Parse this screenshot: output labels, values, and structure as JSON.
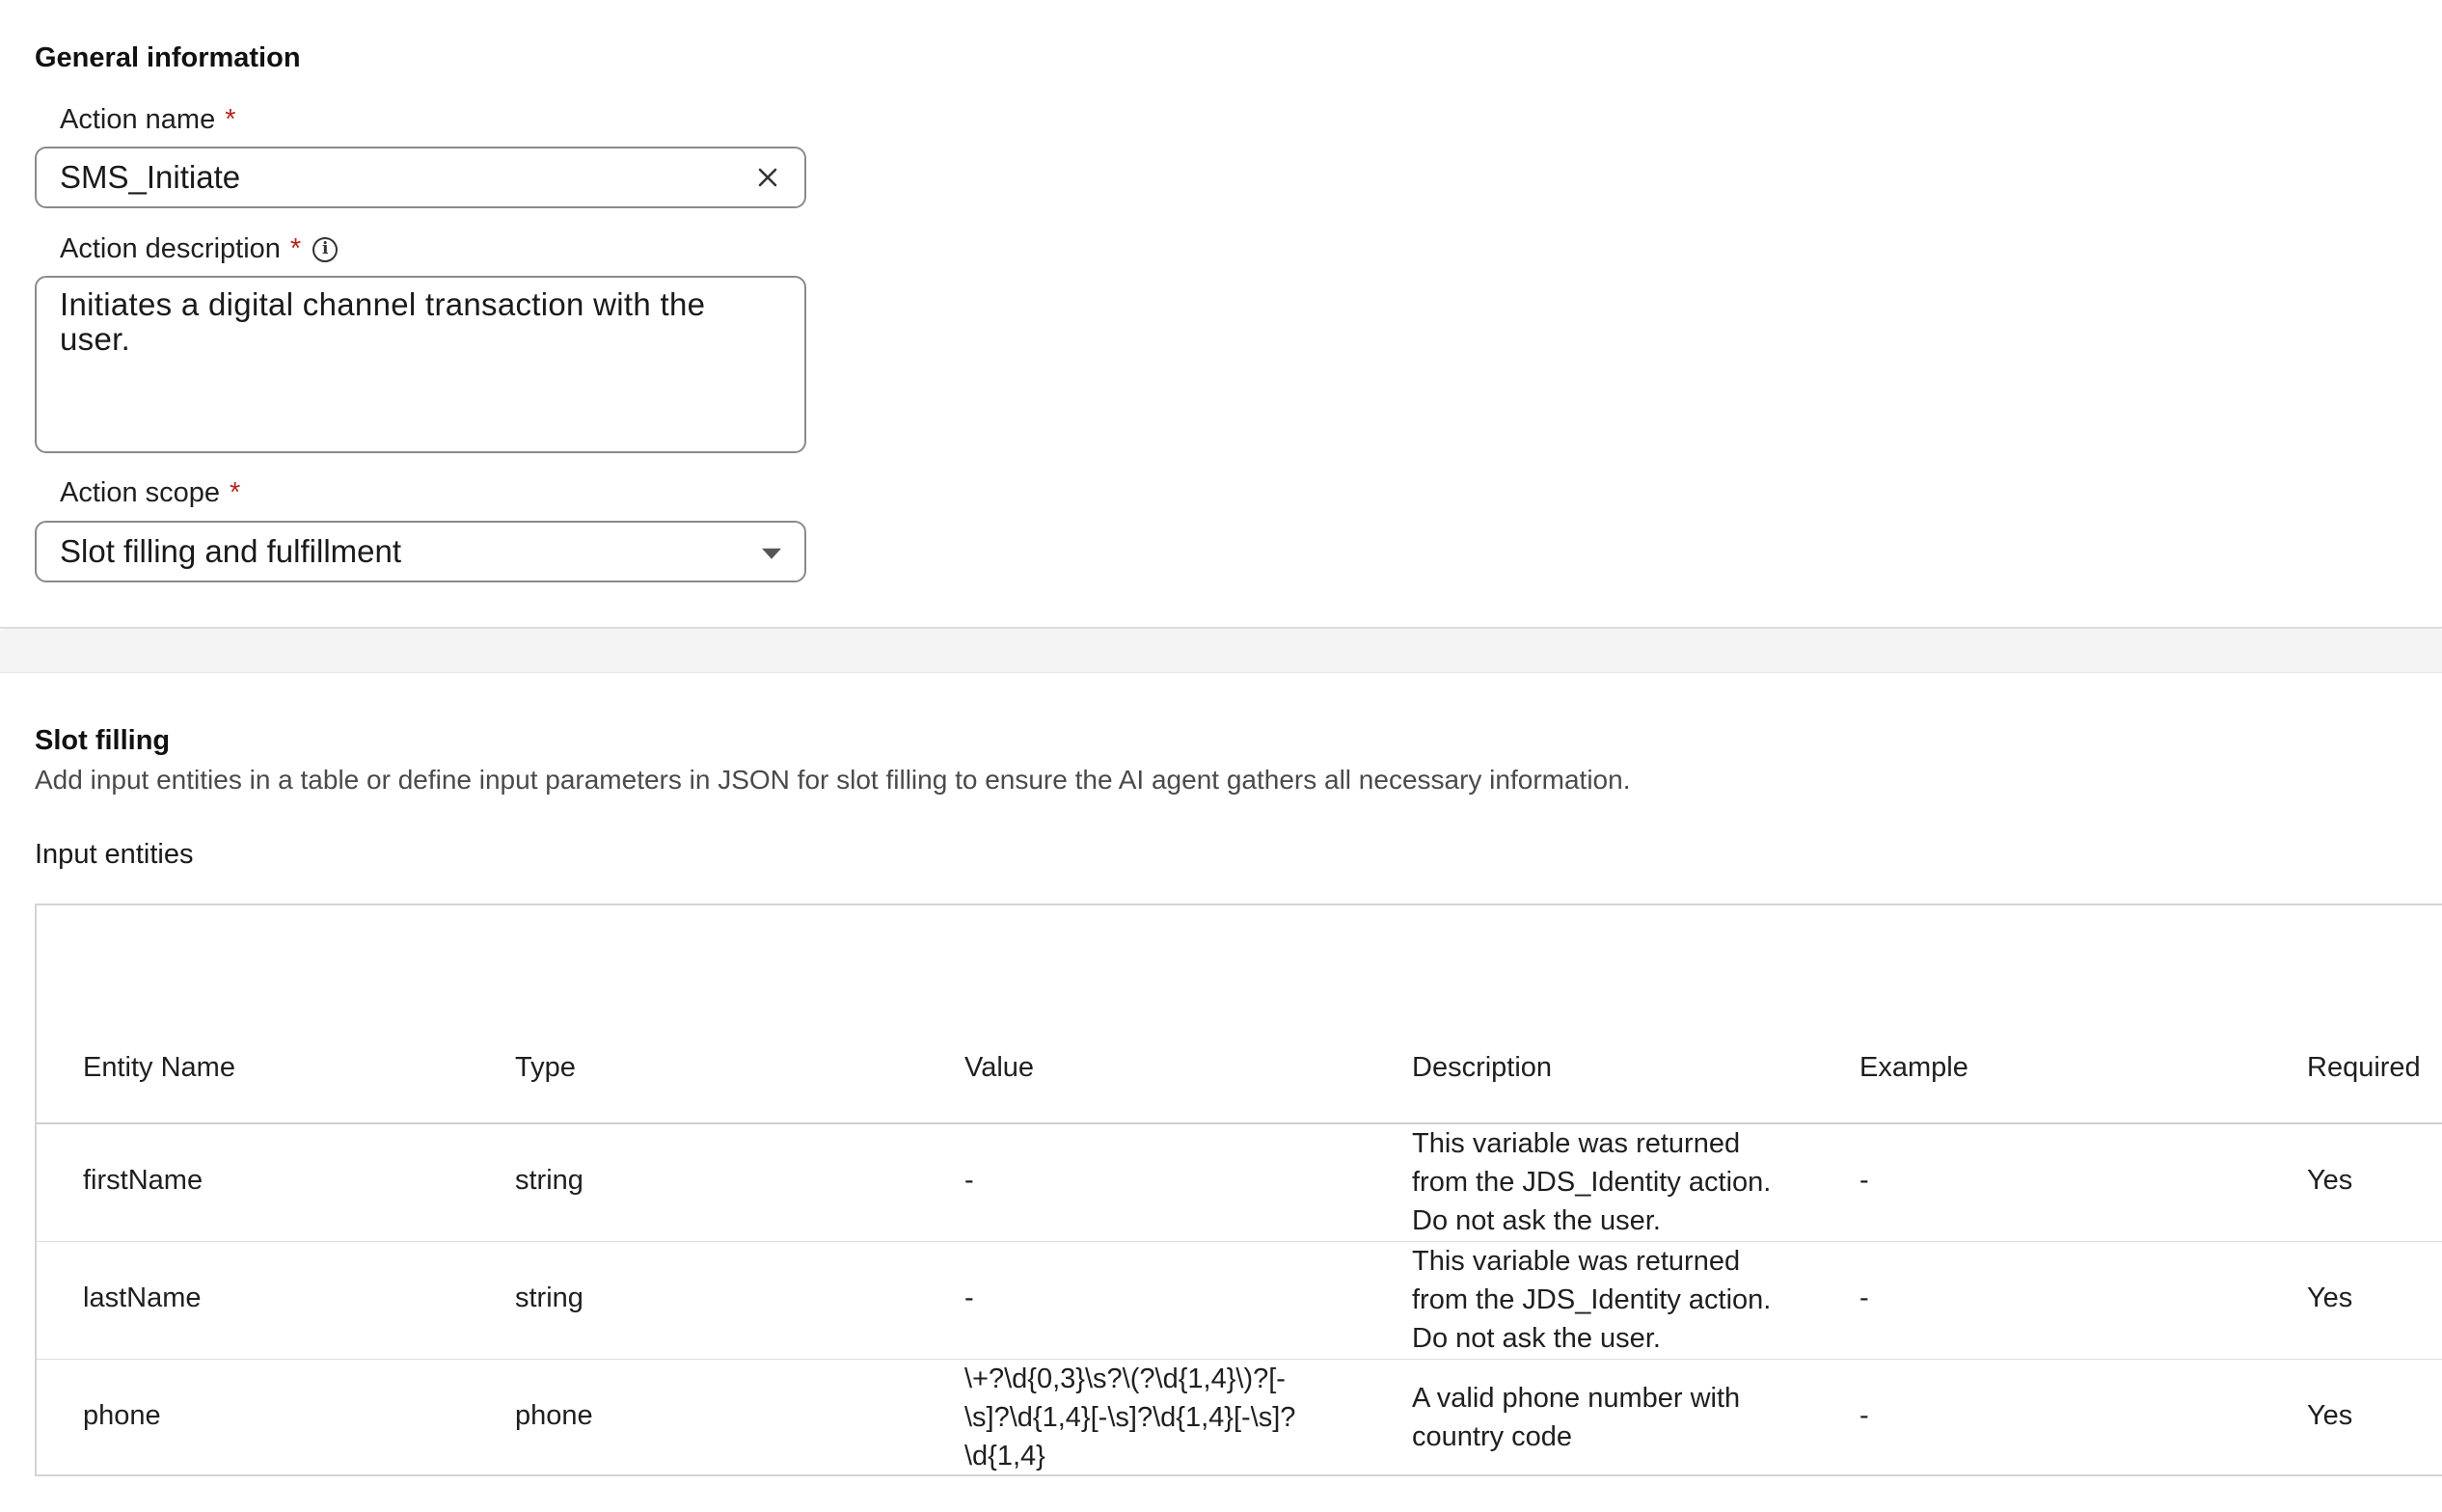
{
  "general": {
    "title": "General information",
    "action_name": {
      "label": "Action name",
      "required_mark": "*",
      "value": "SMS_Initiate"
    },
    "action_description": {
      "label": "Action description",
      "required_mark": "*",
      "info_icon_glyph": "i",
      "value": "Initiates a digital channel transaction with the user."
    },
    "action_scope": {
      "label": "Action scope",
      "required_mark": "*",
      "value": "Slot filling and fulfillment"
    }
  },
  "slot_filling": {
    "title": "Slot filling",
    "description": "Add input entities in a table or define input parameters in JSON for slot filling to ensure the AI agent gathers all necessary information.",
    "input_entities_label": "Input entities",
    "table": {
      "columns": [
        "Entity Name",
        "Type",
        "Value",
        "Description",
        "Example",
        "Required"
      ],
      "rows": [
        {
          "entity": "firstName",
          "type": "string",
          "value": [
            "-"
          ],
          "description": [
            "This variable was returned",
            "from the JDS_Identity action.",
            "Do not ask the user."
          ],
          "example": "-",
          "required": "Yes"
        },
        {
          "entity": "lastName",
          "type": "string",
          "value": [
            "-"
          ],
          "description": [
            "This variable was returned",
            "from the JDS_Identity action.",
            "Do not ask the user."
          ],
          "example": "-",
          "required": "Yes"
        },
        {
          "entity": "phone",
          "type": "phone",
          "value": [
            "\\+?\\d{0,3}\\s?\\(?\\d{1,4}\\)?[-",
            "\\s]?\\d{1,4}[-\\s]?\\d{1,4}[-\\s]?",
            "\\d{1,4}"
          ],
          "description": [
            "A valid phone number with",
            "country code"
          ],
          "example": "-",
          "required": "Yes"
        }
      ]
    }
  },
  "icons": {
    "clear": "close-icon",
    "info": "info-icon",
    "caret": "chevron-down-icon"
  },
  "colors": {
    "required": "#b3261e",
    "border": "#8a8a8a"
  }
}
